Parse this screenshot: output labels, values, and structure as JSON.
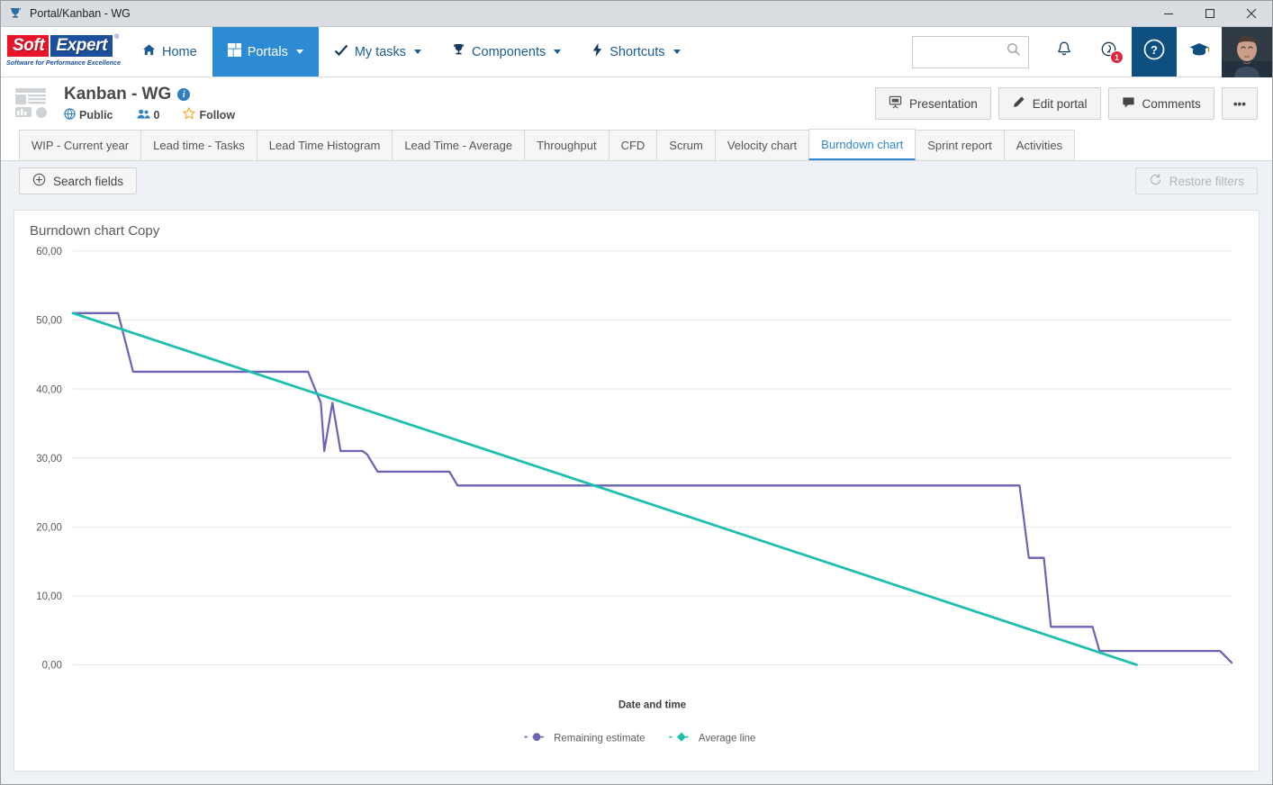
{
  "window": {
    "title": "Portal/Kanban - WG",
    "favicon": "trophy-icon",
    "minimize": "—",
    "maximize": "☐",
    "close": "✕"
  },
  "appbar": {
    "logo": {
      "part1": "Soft",
      "part2": "Expert",
      "registered": "®",
      "tagline": "Software for Performance Excellence"
    },
    "nav": [
      {
        "label": "Home",
        "icon": "home-icon",
        "caret": false,
        "active": false
      },
      {
        "label": "Portals",
        "icon": "grid-icon",
        "caret": true,
        "active": true
      },
      {
        "label": "My tasks",
        "icon": "check-icon",
        "caret": true,
        "active": false
      },
      {
        "label": "Components",
        "icon": "trophy-icon",
        "caret": true,
        "active": false
      },
      {
        "label": "Shortcuts",
        "icon": "bolt-icon",
        "caret": true,
        "active": false
      }
    ],
    "search": {
      "value": "",
      "placeholder": "",
      "icon": "search-icon"
    },
    "icons": [
      {
        "name": "bell-icon",
        "badge": ""
      },
      {
        "name": "alerts-icon",
        "badge": "1"
      },
      {
        "name": "help-icon",
        "badge": ""
      },
      {
        "name": "graduation-cap-icon",
        "badge": ""
      }
    ],
    "avatar": "user-avatar"
  },
  "portal": {
    "icon": "portal-icon",
    "title": "Kanban - WG",
    "info_icon": "info-icon",
    "visibility": {
      "icon": "globe-icon",
      "label": "Public"
    },
    "members": {
      "icon": "users-icon",
      "count": "0"
    },
    "follow": {
      "icon": "star-icon",
      "label": "Follow"
    },
    "actions": [
      {
        "label": "Presentation",
        "icon": "presentation-icon"
      },
      {
        "label": "Edit portal",
        "icon": "pencil-icon"
      },
      {
        "label": "Comments",
        "icon": "comment-icon"
      }
    ],
    "more_label": "•••"
  },
  "tabs": [
    {
      "label": "WIP - Current year",
      "active": false
    },
    {
      "label": "Lead time - Tasks",
      "active": false
    },
    {
      "label": "Lead Time Histogram",
      "active": false
    },
    {
      "label": "Lead Time - Average",
      "active": false
    },
    {
      "label": "Throughput",
      "active": false
    },
    {
      "label": "CFD",
      "active": false
    },
    {
      "label": "Scrum",
      "active": false
    },
    {
      "label": "Velocity chart",
      "active": false
    },
    {
      "label": "Burndown chart",
      "active": true
    },
    {
      "label": "Sprint report",
      "active": false
    },
    {
      "label": "Activities",
      "active": false
    }
  ],
  "filterbar": {
    "search_fields": {
      "label": "Search fields",
      "icon": "plus-circle-icon"
    },
    "restore_filters": {
      "label": "Restore filters",
      "icon": "restore-icon",
      "disabled": true
    }
  },
  "chart_data": {
    "type": "line",
    "title": "Burndown chart Copy",
    "xlabel": "Date and time",
    "ylabel": "",
    "ylim": [
      0,
      60
    ],
    "yticks": [
      "0,00",
      "10,00",
      "20,00",
      "30,00",
      "40,00",
      "50,00",
      "60,00"
    ],
    "ytick_values": [
      0,
      10,
      20,
      30,
      40,
      50,
      60
    ],
    "xticks": [],
    "grid": true,
    "legend_position": "bottom",
    "colors": {
      "remaining": "#6a63b6",
      "average": "#1bbfad"
    },
    "series": [
      {
        "name": "Remaining estimate",
        "marker": "circle",
        "color": "#6a63b6",
        "step": true,
        "points": [
          {
            "x": 0.0,
            "y": 51.0
          },
          {
            "x": 3.9,
            "y": 51.0
          },
          {
            "x": 5.2,
            "y": 42.5
          },
          {
            "x": 20.3,
            "y": 42.5
          },
          {
            "x": 20.9,
            "y": 40.0
          },
          {
            "x": 21.4,
            "y": 38.0
          },
          {
            "x": 21.7,
            "y": 31.0
          },
          {
            "x": 22.4,
            "y": 38.0
          },
          {
            "x": 23.1,
            "y": 31.0
          },
          {
            "x": 25.0,
            "y": 31.0
          },
          {
            "x": 25.4,
            "y": 30.5
          },
          {
            "x": 26.3,
            "y": 28.0
          },
          {
            "x": 32.5,
            "y": 28.0
          },
          {
            "x": 33.2,
            "y": 26.0
          },
          {
            "x": 81.7,
            "y": 26.0
          },
          {
            "x": 82.5,
            "y": 15.5
          },
          {
            "x": 83.8,
            "y": 15.5
          },
          {
            "x": 84.4,
            "y": 5.5
          },
          {
            "x": 88.0,
            "y": 5.5
          },
          {
            "x": 88.6,
            "y": 2.0
          },
          {
            "x": 99.0,
            "y": 2.0
          },
          {
            "x": 100.0,
            "y": 0.3
          }
        ]
      },
      {
        "name": "Average line",
        "marker": "diamond",
        "color": "#1bbfad",
        "step": false,
        "points": [
          {
            "x": 0.0,
            "y": 51.0
          },
          {
            "x": 91.8,
            "y": 0.0
          }
        ]
      }
    ]
  }
}
